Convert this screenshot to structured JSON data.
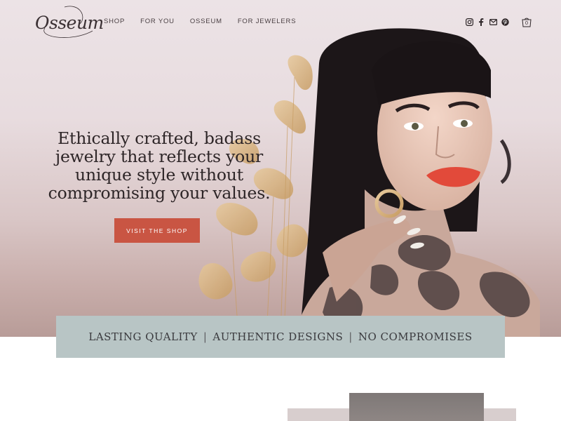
{
  "brand": {
    "logo_text": "Osseum"
  },
  "nav": {
    "links": [
      "SHOP",
      "FOR YOU",
      "OSSEUM",
      "FOR JEWELERS"
    ],
    "icons": [
      "instagram-icon",
      "facebook-icon",
      "email-icon",
      "pinterest-icon"
    ],
    "cart_count": "0"
  },
  "hero": {
    "headline_lines": [
      "Ethically crafted, badass",
      "jewelry that reflects your",
      "unique style without",
      "compromising your values."
    ],
    "cta_label": "VISIT THE SHOP"
  },
  "banner": {
    "items": [
      "LASTING QUALITY",
      "AUTHENTIC DESIGNS",
      "NO COMPROMISES"
    ],
    "separator": "|"
  },
  "colors": {
    "accent": "#c95543",
    "banner_bg": "#b8c5c5",
    "hero_bg": "#e8dcdf",
    "text_dark": "#2d2527"
  }
}
